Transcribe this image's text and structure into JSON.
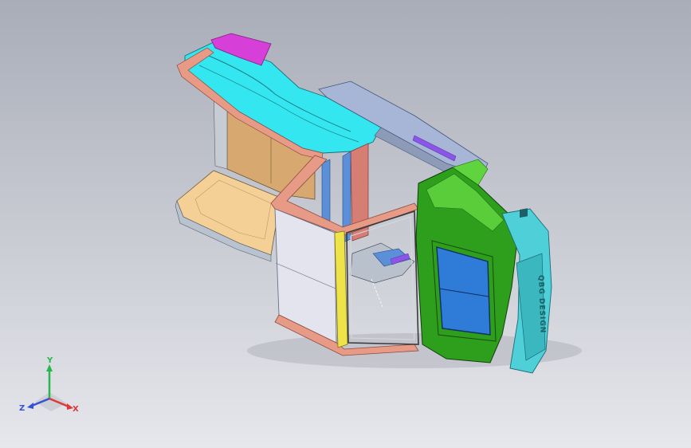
{
  "viewport": {
    "background_top": "#a9adb8",
    "background_bottom": "#e6e7ec"
  },
  "model": {
    "parts": {
      "roof_panel": "#33e6ef",
      "roof_spoiler": "#d63fd8",
      "side_frame": "#e79a86",
      "rear_wall": "#d7a970",
      "floor_panel": "#f4cf96",
      "door_panel": "#e4e4ef",
      "door_frame": "#efe34a",
      "upper_rail": "#a7b6d6",
      "pillar_salmon": "#d67e74",
      "pillar_blue": "#5b8fd8",
      "front_shell": "#2e9e1d",
      "front_shell_light": "#5fd43e",
      "windshield": "#2e7bd8",
      "bumper": "#4fd0d8",
      "purple_bar": "#8b55e8"
    },
    "emboss_text": "QBG DESIGN"
  },
  "triad": {
    "y_label": "Y",
    "x_label": "X",
    "z_label": "Z",
    "y_color": "#27b84c",
    "x_color": "#e0383a",
    "z_color": "#3452d4"
  }
}
